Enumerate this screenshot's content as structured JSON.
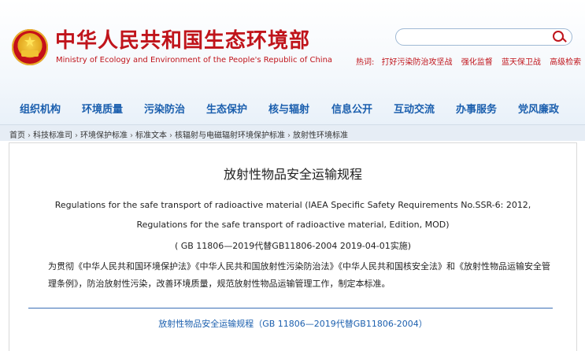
{
  "site": {
    "title_cn": "中华人民共和国生态环境部",
    "title_en": "Ministry of Ecology and Environment of the People's Republic of China",
    "search_placeholder": ""
  },
  "hot_words": {
    "label": "热词:",
    "items": [
      "打好污染防治攻坚战",
      "强化监督",
      "蓝天保卫战",
      "高级检索"
    ]
  },
  "nav": [
    "组织机构",
    "环境质量",
    "污染防治",
    "生态保护",
    "核与辐射",
    "信息公开",
    "互动交流",
    "办事服务",
    "党风廉政"
  ],
  "breadcrumb": [
    "首页",
    "科技标准司",
    "环境保护标准",
    "标准文本",
    "核辐射与电磁辐射环境保护标准",
    "放射性环境标准"
  ],
  "breadcrumb_sep": "›",
  "doc": {
    "title": "放射性物品安全运输规程",
    "line1": "Regulations for the safe transport of radioactive material  (IAEA Specific Safety Requirements No.SSR-6: 2012,",
    "line2": "Regulations for the safe transport of radioactive material, Edition, MOD)",
    "line3": "( GB 11806—2019代替GB11806-2004 2019-04-01实施)",
    "para": "为贯彻《中华人民共和国环境保护法》《中华人民共和国放射性污染防治法》《中华人民共和国核安全法》和《放射性物品运输安全管理条例》，防治放射性污染，改善环境质量，规范放射性物品运输管理工作，制定本标准。",
    "link": "放射性物品安全运输规程（GB 11806—2019代替GB11806-2004）"
  },
  "colors": {
    "brand_red": "#c0141b",
    "nav_blue": "#1b5fae",
    "rule_blue": "#3b6fb6"
  }
}
